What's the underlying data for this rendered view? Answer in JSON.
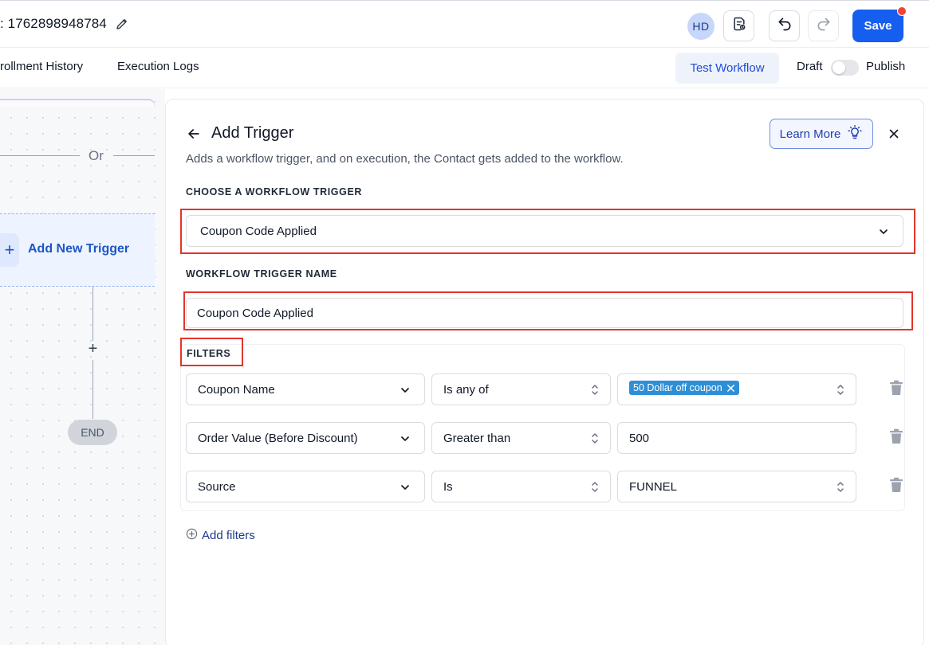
{
  "header": {
    "workflow_title": ": 1762898948784",
    "avatar_initials": "HD",
    "save_label": "Save"
  },
  "subnav": {
    "tabs": [
      "rollment History",
      "Execution Logs"
    ],
    "test_workflow_label": "Test Workflow",
    "draft_label": "Draft",
    "publish_label": "Publish",
    "publish_on": false
  },
  "canvas": {
    "or_label": "Or",
    "add_trigger_label": "Add New Trigger",
    "end_label": "END"
  },
  "panel": {
    "title": "Add Trigger",
    "description": "Adds a workflow trigger, and on execution, the Contact gets added to the workflow.",
    "learn_more_label": "Learn More",
    "choose_trigger_label": "CHOOSE A WORKFLOW TRIGGER",
    "selected_trigger": "Coupon Code Applied",
    "trigger_name_label": "WORKFLOW TRIGGER NAME",
    "trigger_name_value": "Coupon Code Applied",
    "filters_label": "FILTERS",
    "filters": [
      {
        "field": "Coupon Name",
        "operator": "Is any of",
        "value_tag": "50 Dollar off coupon",
        "value": ""
      },
      {
        "field": "Order Value (Before Discount)",
        "operator": "Greater than",
        "value_tag": "",
        "value": "500"
      },
      {
        "field": "Source",
        "operator": "Is",
        "value_tag": "",
        "value": "FUNNEL"
      }
    ],
    "add_filters_label": "Add filters"
  },
  "colors": {
    "primary": "#155eef",
    "highlight": "#e3352b",
    "tag": "#2e8fd6",
    "notification": "#f04438"
  }
}
